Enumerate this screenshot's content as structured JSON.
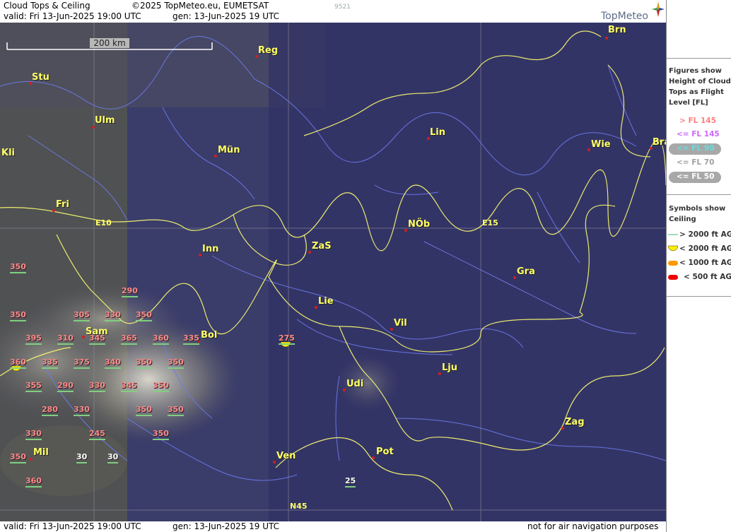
{
  "header": {
    "title": "Cloud Tops & Ceiling",
    "copyright": "©2025 TopMeteo.eu, EUMETSAT",
    "valid": "valid:  Fri  13-Jun-2025  19:00 UTC",
    "gen": "gen: 13-Jun-2025 19 UTC",
    "code": "9521",
    "logo": "TopMeteo"
  },
  "footer": {
    "valid": "valid:  Fri  13-Jun-2025  19:00 UTC",
    "gen": "gen: 13-Jun-2025 19 UTC",
    "disclaimer": "not for air navigation purposes"
  },
  "scale": {
    "label": "200 km"
  },
  "grid_labels": [
    "E10",
    "E15",
    "N45"
  ],
  "cities": [
    {
      "name": "Brn"
    },
    {
      "name": "Reg"
    },
    {
      "name": "Stu"
    },
    {
      "name": "Ulm"
    },
    {
      "name": "Kli"
    },
    {
      "name": "Mün"
    },
    {
      "name": "Lin"
    },
    {
      "name": "Wie"
    },
    {
      "name": "Bra"
    },
    {
      "name": "Fri"
    },
    {
      "name": "NÖb"
    },
    {
      "name": "ZaS"
    },
    {
      "name": "Inn"
    },
    {
      "name": "Gra"
    },
    {
      "name": "Lie"
    },
    {
      "name": "Vil"
    },
    {
      "name": "Sam"
    },
    {
      "name": "Bol"
    },
    {
      "name": "Lju"
    },
    {
      "name": "Udi"
    },
    {
      "name": "Zag"
    },
    {
      "name": "Pot"
    },
    {
      "name": "Mil"
    },
    {
      "name": "Ven"
    }
  ],
  "flight_levels": [
    "350",
    "290",
    "350",
    "305",
    "330",
    "350",
    "395",
    "310",
    "345",
    "365",
    "360",
    "335",
    "275",
    "360",
    "335",
    "375",
    "340",
    "350",
    "350",
    "355",
    "290",
    "330",
    "345",
    "350",
    "280",
    "330",
    "350",
    "350",
    "330",
    "245",
    "350",
    "350",
    "30",
    "30",
    "360",
    "25"
  ],
  "legend": {
    "tops_title": [
      "Figures show",
      "Height of Cloud",
      "Tops as Flight",
      "Level  [FL]"
    ],
    "tops": [
      {
        "label": "> FL 145",
        "color": "#ff7f7f"
      },
      {
        "label": "<= FL 145",
        "color": "#cc66ff"
      },
      {
        "label": "<= FL 90",
        "color": "#66dddd"
      },
      {
        "label": "<= FL 70",
        "color": "#a0a0a0"
      },
      {
        "label": "<= FL 50",
        "color": "#ffffff"
      }
    ],
    "ceiling_title": [
      "Symbols show",
      "Ceiling"
    ],
    "ceiling": [
      {
        "label": "> 2000 ft AGL",
        "color": "#7fd0a0"
      },
      {
        "label": "< 2000 ft AGL",
        "color": "#ffee00"
      },
      {
        "label": "< 1000 ft AGL",
        "color": "#ff9900"
      },
      {
        "label": "< 500 ft AGL",
        "color": "#ee0000"
      }
    ]
  }
}
